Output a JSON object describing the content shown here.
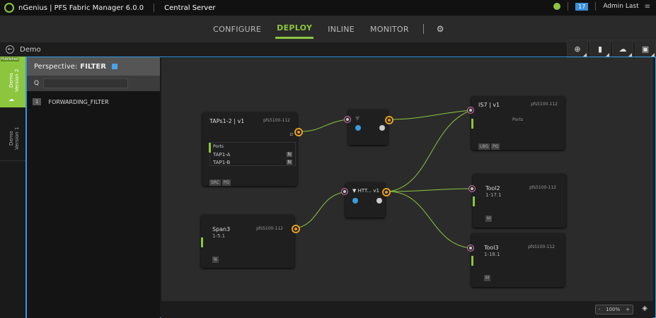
{
  "header": {
    "app_title": "nGenius | PFS Fabric Manager 6.0.0",
    "server": "Central Server",
    "notifications_count": "17",
    "user": "Admin Last"
  },
  "nav": {
    "tabs": [
      {
        "label": "CONFIGURE"
      },
      {
        "label": "DEPLOY"
      },
      {
        "label": "INLINE"
      },
      {
        "label": "MONITOR"
      }
    ],
    "active_tab": "DEPLOY"
  },
  "breadcrumb": {
    "name": "Demo"
  },
  "versions": {
    "published_label": "Published",
    "active": "Demo\nVersion 2",
    "inactive": "Demo\nVersion 1"
  },
  "left_panel": {
    "perspective_label": "Perspective:",
    "perspective_value": "FILTER",
    "search_placeholder": "",
    "filters": [
      {
        "index": "1",
        "name": "FORWARDING_FILTER"
      }
    ]
  },
  "nodes": {
    "taps": {
      "title": "TAPs1-2 | v1",
      "model": "pfs5100-112",
      "ports_header": "Ports",
      "ports": [
        {
          "name": "TAP1-A",
          "flag": "N"
        },
        {
          "name": "TAP1-B",
          "flag": "N"
        }
      ],
      "tags": [
        "SRC",
        "PG"
      ]
    },
    "span3": {
      "title": "Span3",
      "sub": "1-5.1",
      "model": "pfs5100-112",
      "tags": [
        "N"
      ]
    },
    "filter1": {
      "title": ""
    },
    "filter2": {
      "title": "HTT... v1"
    },
    "is7": {
      "title": "IS7 | v1",
      "model": "pfs5100-112",
      "ports_label": "Ports",
      "tags": [
        "LBG",
        "PG"
      ]
    },
    "tool2": {
      "title": "Tool2",
      "sub": "1-17.1",
      "model": "pfs5100-112",
      "tags": [
        "M"
      ]
    },
    "tool3": {
      "title": "Tool3",
      "sub": "1-18.1",
      "model": "pfs5100-112",
      "tags": [
        "M"
      ]
    }
  },
  "zoom": {
    "minus": "-",
    "value": "100%",
    "plus": "+"
  },
  "colors": {
    "accent": "#8cc63f",
    "selection": "#2d9ae0",
    "port": "#e8a020"
  }
}
